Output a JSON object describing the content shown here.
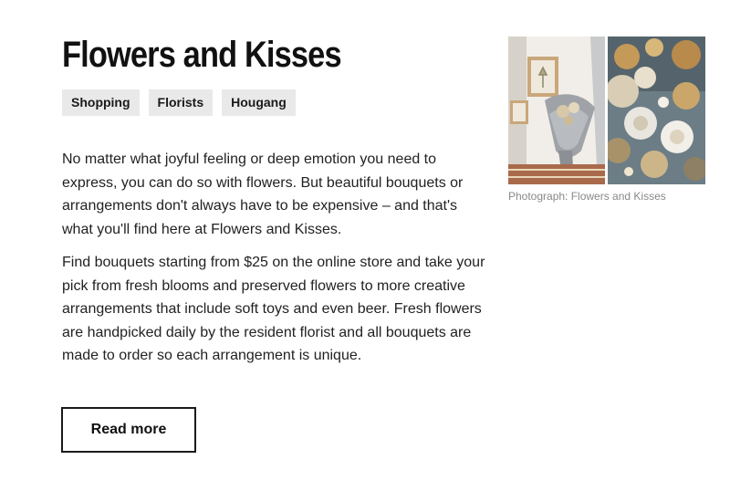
{
  "venue": {
    "title": "Flowers and Kisses",
    "tags": [
      "Shopping",
      "Florists",
      "Hougang"
    ]
  },
  "description": {
    "paragraphs": [
      "No matter what joyful feeling or deep emotion you need to express, you can do so with flowers. But beautiful bouquets or arrangements don't always have to be expensive – and that's what you'll find here at Flowers and Kisses.",
      "Find bouquets starting from $25 on the online store and take your pick from fresh blooms and preserved flowers to more creative arrangements that include soft toys and even beer. Fresh flowers are handpicked daily by the resident florist and all bouquets are made to order so each arrangement is unique."
    ]
  },
  "actions": {
    "read_more_label": "Read more"
  },
  "photo": {
    "caption": "Photograph: Flowers and Kisses"
  },
  "colors": {
    "tag_background": "#e9e9e9",
    "button_border": "#1a1a1a",
    "caption": "#888888"
  }
}
